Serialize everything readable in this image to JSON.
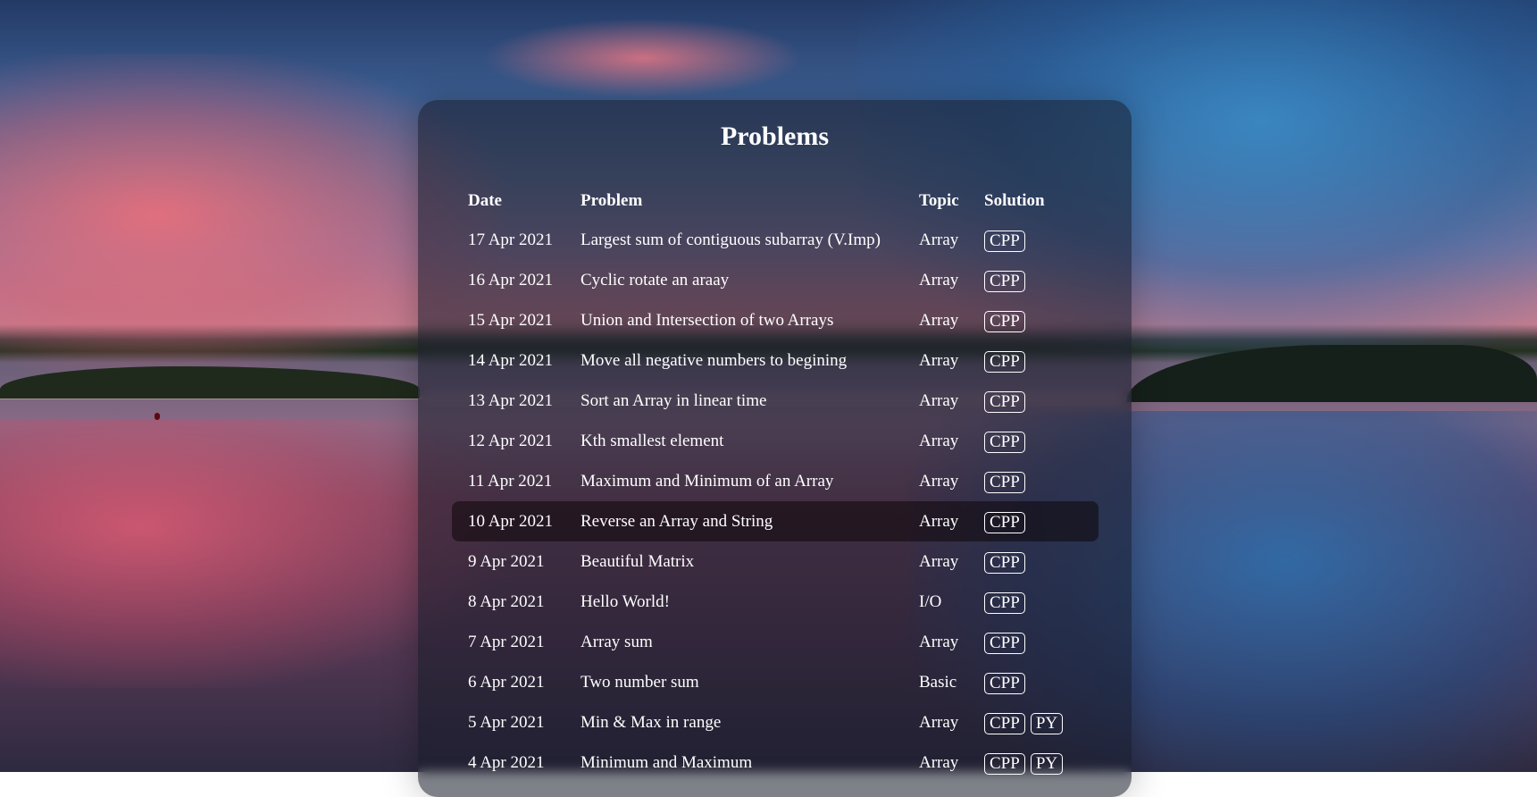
{
  "page": {
    "title": "Problems"
  },
  "table": {
    "headers": {
      "date": "Date",
      "problem": "Problem",
      "topic": "Topic",
      "solution": "Solution"
    },
    "rows": [
      {
        "date": "17 Apr 2021",
        "problem": "Largest sum of contiguous subarray (V.Imp)",
        "topic": "Array",
        "solutions": [
          "CPP"
        ]
      },
      {
        "date": "16 Apr 2021",
        "problem": "Cyclic rotate an araay",
        "topic": "Array",
        "solutions": [
          "CPP"
        ]
      },
      {
        "date": "15 Apr 2021",
        "problem": "Union and Intersection of two Arrays",
        "topic": "Array",
        "solutions": [
          "CPP"
        ]
      },
      {
        "date": "14 Apr 2021",
        "problem": "Move all negative numbers to begining",
        "topic": "Array",
        "solutions": [
          "CPP"
        ]
      },
      {
        "date": "13 Apr 2021",
        "problem": "Sort an Array in linear time",
        "topic": "Array",
        "solutions": [
          "CPP"
        ]
      },
      {
        "date": "12 Apr 2021",
        "problem": "Kth smallest element",
        "topic": "Array",
        "solutions": [
          "CPP"
        ]
      },
      {
        "date": "11 Apr 2021",
        "problem": "Maximum and Minimum of an Array",
        "topic": "Array",
        "solutions": [
          "CPP"
        ]
      },
      {
        "date": "10 Apr 2021",
        "problem": "Reverse an Array and String",
        "topic": "Array",
        "solutions": [
          "CPP"
        ],
        "highlighted": true
      },
      {
        "date": "9 Apr 2021",
        "problem": "Beautiful Matrix",
        "topic": "Array",
        "solutions": [
          "CPP"
        ]
      },
      {
        "date": "8 Apr 2021",
        "problem": "Hello World!",
        "topic": "I/O",
        "solutions": [
          "CPP"
        ]
      },
      {
        "date": "7 Apr 2021",
        "problem": "Array sum",
        "topic": "Array",
        "solutions": [
          "CPP"
        ]
      },
      {
        "date": "6 Apr 2021",
        "problem": "Two number sum",
        "topic": "Basic",
        "solutions": [
          "CPP"
        ]
      },
      {
        "date": "5 Apr 2021",
        "problem": "Min & Max in range",
        "topic": "Array",
        "solutions": [
          "CPP",
          "PY"
        ]
      },
      {
        "date": "4 Apr 2021",
        "problem": "Minimum and Maximum",
        "topic": "Array",
        "solutions": [
          "CPP",
          "PY"
        ]
      }
    ]
  }
}
